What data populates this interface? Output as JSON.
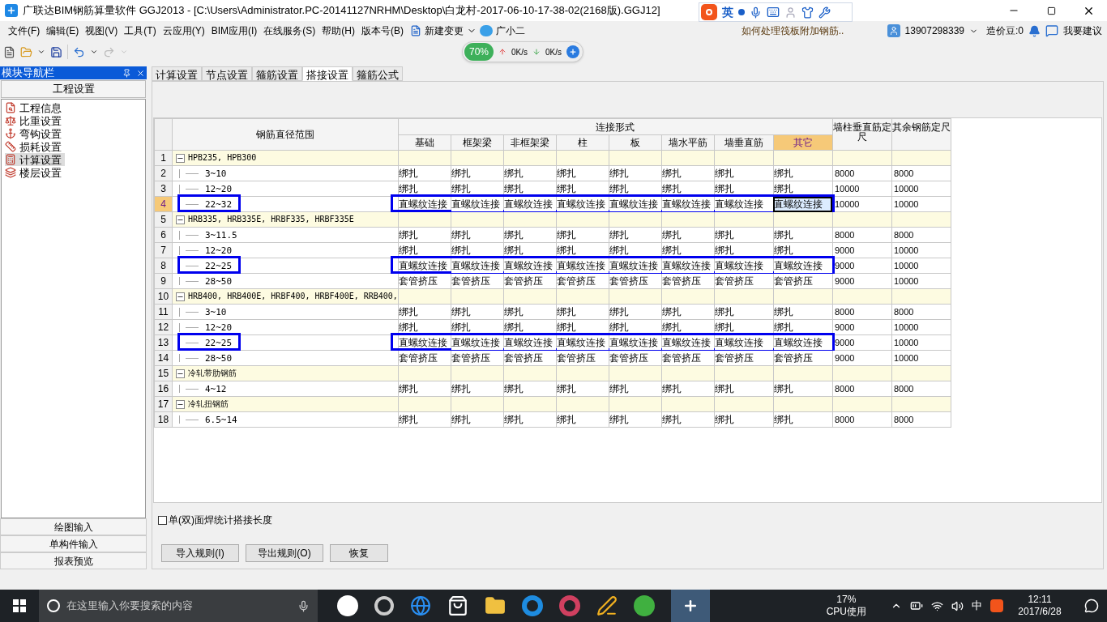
{
  "window": {
    "title": "广联达BIM钢筋算量软件 GGJ2013 - [C:\\Users\\Administrator.PC-20141127NRHM\\Desktop\\白龙村-2017-06-10-17-38-02(2168版).GGJ12]"
  },
  "ime_bar": {
    "mode": "英"
  },
  "menu": [
    "文件(F)",
    "编辑(E)",
    "视图(V)",
    "工具(T)",
    "云应用(Y)",
    "BIM应用(I)",
    "在线服务(S)",
    "帮助(H)",
    "版本号(B)"
  ],
  "menu_extra": {
    "new_change": "新建变更",
    "assistant": "广小二"
  },
  "hint": "如何处理筏板附加钢筋..",
  "account": {
    "phone": "13907298339",
    "beans": "造价豆:0",
    "suggest": "我要建议"
  },
  "net_widget": {
    "percent": "70%",
    "up": "0K/s",
    "down": "0K/s"
  },
  "nav": {
    "title": "模块导航栏",
    "section": "工程设置",
    "items": [
      {
        "label": "工程信息",
        "selected": false
      },
      {
        "label": "比重设置",
        "selected": false
      },
      {
        "label": "弯钩设置",
        "selected": false
      },
      {
        "label": "损耗设置",
        "selected": false
      },
      {
        "label": "计算设置",
        "selected": true
      },
      {
        "label": "楼层设置",
        "selected": false
      }
    ],
    "bottom": [
      "绘图输入",
      "单构件输入",
      "报表预览"
    ]
  },
  "tabs": [
    {
      "label": "计算设置",
      "selected": false
    },
    {
      "label": "节点设置",
      "selected": false
    },
    {
      "label": "箍筋设置",
      "selected": false
    },
    {
      "label": "搭接设置",
      "selected": true
    },
    {
      "label": "箍筋公式",
      "selected": false
    }
  ],
  "table": {
    "range_header": "钢筋直径范围",
    "group_header": "连接形式",
    "connection_columns": [
      {
        "label": "基础",
        "selected": false
      },
      {
        "label": "框架梁",
        "selected": false
      },
      {
        "label": "非框架梁",
        "selected": false
      },
      {
        "label": "柱",
        "selected": false
      },
      {
        "label": "板",
        "selected": false
      },
      {
        "label": "墙水平筋",
        "selected": false
      },
      {
        "label": "墙垂直筋",
        "selected": false
      },
      {
        "label": "其它",
        "selected": true
      }
    ],
    "extra_columns": [
      "墙柱垂直筋定尺",
      "其余钢筋定尺"
    ],
    "groups": [
      {
        "num": "1",
        "label": "HPB235, HPB300",
        "expanded": true,
        "children": [
          {
            "num": "2",
            "label": "3~10",
            "cells": [
              "绑扎",
              "绑扎",
              "绑扎",
              "绑扎",
              "绑扎",
              "绑扎",
              "绑扎",
              "绑扎"
            ],
            "wall": "8000",
            "other": "8000",
            "selected": false,
            "marked": false
          },
          {
            "num": "3",
            "label": "12~20",
            "cells": [
              "绑扎",
              "绑扎",
              "绑扎",
              "绑扎",
              "绑扎",
              "绑扎",
              "绑扎",
              "绑扎"
            ],
            "wall": "10000",
            "other": "10000",
            "selected": false,
            "marked": false
          },
          {
            "num": "4",
            "label": "22~32",
            "cells": [
              "直螺纹连接",
              "直螺纹连接",
              "直螺纹连接",
              "直螺纹连接",
              "直螺纹连接",
              "直螺纹连接",
              "直螺纹连接",
              "直螺纹连接"
            ],
            "wall": "10000",
            "other": "10000",
            "selected": true,
            "marked": true
          }
        ]
      },
      {
        "num": "5",
        "label": "HRB335, HRB335E, HRBF335, HRBF335E",
        "expanded": true,
        "children": [
          {
            "num": "6",
            "label": "3~11.5",
            "cells": [
              "绑扎",
              "绑扎",
              "绑扎",
              "绑扎",
              "绑扎",
              "绑扎",
              "绑扎",
              "绑扎"
            ],
            "wall": "8000",
            "other": "8000",
            "selected": false,
            "marked": false
          },
          {
            "num": "7",
            "label": "12~20",
            "cells": [
              "绑扎",
              "绑扎",
              "绑扎",
              "绑扎",
              "绑扎",
              "绑扎",
              "绑扎",
              "绑扎"
            ],
            "wall": "9000",
            "other": "10000",
            "selected": false,
            "marked": false
          },
          {
            "num": "8",
            "label": "22~25",
            "cells": [
              "直螺纹连接",
              "直螺纹连接",
              "直螺纹连接",
              "直螺纹连接",
              "直螺纹连接",
              "直螺纹连接",
              "直螺纹连接",
              "直螺纹连接"
            ],
            "wall": "9000",
            "other": "10000",
            "selected": false,
            "marked": true
          },
          {
            "num": "9",
            "label": "28~50",
            "cells": [
              "套管挤压",
              "套管挤压",
              "套管挤压",
              "套管挤压",
              "套管挤压",
              "套管挤压",
              "套管挤压",
              "套管挤压"
            ],
            "wall": "9000",
            "other": "10000",
            "selected": false,
            "marked": false
          }
        ]
      },
      {
        "num": "10",
        "label": "HRB400, HRB400E, HRBF400, HRBF400E, RRB400,",
        "expanded": true,
        "children": [
          {
            "num": "11",
            "label": "3~10",
            "cells": [
              "绑扎",
              "绑扎",
              "绑扎",
              "绑扎",
              "绑扎",
              "绑扎",
              "绑扎",
              "绑扎"
            ],
            "wall": "8000",
            "other": "8000",
            "selected": false,
            "marked": false
          },
          {
            "num": "12",
            "label": "12~20",
            "cells": [
              "绑扎",
              "绑扎",
              "绑扎",
              "绑扎",
              "绑扎",
              "绑扎",
              "绑扎",
              "绑扎"
            ],
            "wall": "9000",
            "other": "10000",
            "selected": false,
            "marked": false
          },
          {
            "num": "13",
            "label": "22~25",
            "cells": [
              "直螺纹连接",
              "直螺纹连接",
              "直螺纹连接",
              "直螺纹连接",
              "直螺纹连接",
              "直螺纹连接",
              "直螺纹连接",
              "直螺纹连接"
            ],
            "wall": "9000",
            "other": "10000",
            "selected": false,
            "marked": true
          },
          {
            "num": "14",
            "label": "28~50",
            "cells": [
              "套管挤压",
              "套管挤压",
              "套管挤压",
              "套管挤压",
              "套管挤压",
              "套管挤压",
              "套管挤压",
              "套管挤压"
            ],
            "wall": "9000",
            "other": "10000",
            "selected": false,
            "marked": false
          }
        ]
      },
      {
        "num": "15",
        "label": "冷轧带肋钢筋",
        "expanded": true,
        "children": [
          {
            "num": "16",
            "label": "4~12",
            "cells": [
              "绑扎",
              "绑扎",
              "绑扎",
              "绑扎",
              "绑扎",
              "绑扎",
              "绑扎",
              "绑扎"
            ],
            "wall": "8000",
            "other": "8000",
            "selected": false,
            "marked": false
          }
        ]
      },
      {
        "num": "17",
        "label": "冷轧扭钢筋",
        "expanded": true,
        "children": [
          {
            "num": "18",
            "label": "6.5~14",
            "cells": [
              "绑扎",
              "绑扎",
              "绑扎",
              "绑扎",
              "绑扎",
              "绑扎",
              "绑扎",
              "绑扎"
            ],
            "wall": "8000",
            "other": "8000",
            "selected": false,
            "marked": false
          }
        ]
      }
    ]
  },
  "weld_option": {
    "label": "单(双)面焊统计搭接长度",
    "checked": false
  },
  "buttons": [
    "导入规则(I)",
    "导出规则(O)",
    "恢复"
  ],
  "taskbar": {
    "search_placeholder": "在这里输入你要搜索的内容",
    "cpu": "17%",
    "cpu_label": "CPU使用",
    "ime": "中",
    "time": "12:11",
    "date": "2017/6/28"
  }
}
